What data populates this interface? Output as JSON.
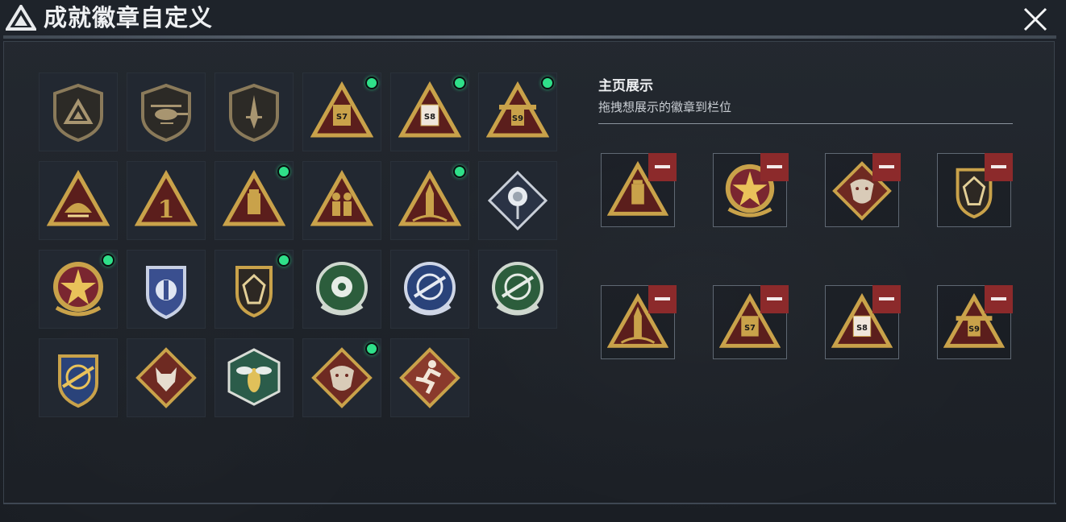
{
  "window": {
    "title": "成就徽章自定义",
    "close_label": "close"
  },
  "colors": {
    "gold": "#c9a24a",
    "dark_red": "#5b1e1c",
    "new_indicator": "#2fe089",
    "remove_button": "#8c2a2b"
  },
  "badge_grid": {
    "rows": [
      [
        {
          "icon": "delta-shield-icon",
          "is_new": false
        },
        {
          "icon": "helicopter-shield-icon",
          "is_new": false
        },
        {
          "icon": "dagger-shield-icon",
          "is_new": false
        },
        {
          "icon": "s7-triangle-badge-icon",
          "is_new": true
        },
        {
          "icon": "s8-triangle-badge-icon",
          "is_new": true
        },
        {
          "icon": "s9-triangle-badge-icon",
          "is_new": true
        }
      ],
      [
        {
          "icon": "shell-triangle-badge-icon",
          "is_new": false
        },
        {
          "icon": "number-one-triangle-badge-icon",
          "is_new": false
        },
        {
          "icon": "canister-triangle-badge-icon",
          "is_new": true
        },
        {
          "icon": "soldiers-triangle-badge-icon",
          "is_new": false
        },
        {
          "icon": "rocket-triangle-badge-icon",
          "is_new": true
        },
        {
          "icon": "rose-diamond-badge-icon",
          "is_new": false
        }
      ],
      [
        {
          "icon": "star-ring-badge-icon",
          "is_new": true
        },
        {
          "icon": "blue-police-badge-icon",
          "is_new": false
        },
        {
          "icon": "crystal-shield-badge-icon",
          "is_new": true
        },
        {
          "icon": "green-crosshair-badge-icon",
          "is_new": false
        },
        {
          "icon": "blue-rifle-crosshair-badge-icon",
          "is_new": false
        },
        {
          "icon": "green-rifle-crosshair-badge-icon",
          "is_new": false
        }
      ],
      [
        {
          "icon": "gold-rifle-crest-badge-icon",
          "is_new": false
        },
        {
          "icon": "wolf-diamond-badge-icon",
          "is_new": false
        },
        {
          "icon": "wasp-hexagon-badge-icon",
          "is_new": false
        },
        {
          "icon": "dragon-diamond-badge-icon",
          "is_new": true
        },
        {
          "icon": "runner-diamond-badge-icon",
          "is_new": false
        }
      ]
    ]
  },
  "showcase": {
    "title": "主页展示",
    "subtitle": "拖拽想展示的徽章到栏位",
    "slots": [
      {
        "icon": "canister-triangle-badge-icon"
      },
      {
        "icon": "star-ring-badge-icon"
      },
      {
        "icon": "dragon-diamond-badge-icon"
      },
      {
        "icon": "crystal-shield-badge-icon"
      },
      {
        "icon": "rocket-triangle-badge-icon"
      },
      {
        "icon": "s7-triangle-badge-icon"
      },
      {
        "icon": "s8-triangle-badge-icon"
      },
      {
        "icon": "s9-triangle-badge-icon"
      }
    ]
  },
  "badge_text": {
    "s7": "S7",
    "s8": "S8",
    "s9": "S9",
    "one": "1"
  }
}
